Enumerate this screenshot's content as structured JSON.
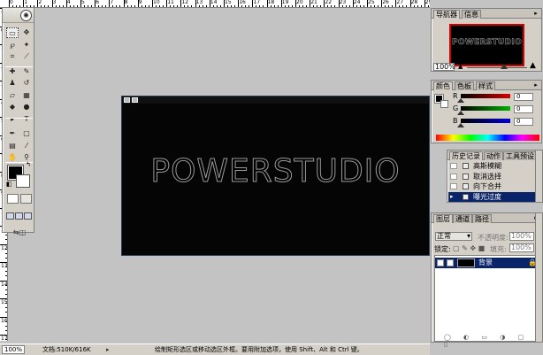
{
  "ruler": {
    "top_labels": [
      "0",
      "1",
      "2",
      "3",
      "4",
      "5",
      "6",
      "7",
      "8",
      "9",
      "10",
      "11",
      "12",
      "13",
      "14",
      "15",
      "16",
      "17",
      "18",
      "19",
      "20",
      "21",
      "22",
      "23",
      "24",
      "25",
      "26",
      "27",
      "28",
      "29"
    ],
    "left_labels": [
      "-1",
      "0",
      "1",
      "2",
      "3",
      "4",
      "5",
      "6",
      "7",
      "8",
      "9",
      "10",
      "11",
      "12",
      "13",
      "14",
      "15",
      "16",
      "17"
    ]
  },
  "toolbox": {
    "tools": [
      {
        "icon": "marquee-rect-icon",
        "glyph": "▭"
      },
      {
        "icon": "move-icon",
        "glyph": "✥"
      },
      {
        "icon": "lasso-icon",
        "glyph": "℘"
      },
      {
        "icon": "magic-wand-icon",
        "glyph": "✦"
      },
      {
        "icon": "crop-icon",
        "glyph": "⌗"
      },
      {
        "icon": "slice-icon",
        "glyph": "⟋"
      },
      {
        "icon": "healing-brush-icon",
        "glyph": "✚"
      },
      {
        "icon": "brush-icon",
        "glyph": "✎"
      },
      {
        "icon": "clone-stamp-icon",
        "glyph": "♟"
      },
      {
        "icon": "history-brush-icon",
        "glyph": "↺"
      },
      {
        "icon": "eraser-icon",
        "glyph": "▱"
      },
      {
        "icon": "gradient-icon",
        "glyph": "▦"
      },
      {
        "icon": "blur-icon",
        "glyph": "◆"
      },
      {
        "icon": "dodge-icon",
        "glyph": "●"
      },
      {
        "icon": "path-select-icon",
        "glyph": "▸"
      },
      {
        "icon": "type-icon",
        "glyph": "T"
      },
      {
        "icon": "pen-icon",
        "glyph": "✒"
      },
      {
        "icon": "shape-icon",
        "glyph": "▢"
      },
      {
        "icon": "notes-icon",
        "glyph": "▤"
      },
      {
        "icon": "eyedropper-icon",
        "glyph": "⁄"
      },
      {
        "icon": "hand-icon",
        "glyph": "✋"
      },
      {
        "icon": "zoom-icon",
        "glyph": "⚲"
      }
    ]
  },
  "document": {
    "text": "POWERSTUDIO"
  },
  "navigator": {
    "tabs": [
      "导航器",
      "信息"
    ],
    "preview_text": "POWERSTUDIO",
    "zoom": "100%"
  },
  "color": {
    "tabs": [
      "颜色",
      "色板",
      "样式"
    ],
    "channels": [
      {
        "label": "R",
        "value": "0",
        "color": "#d40000"
      },
      {
        "label": "G",
        "value": "0",
        "color": "#00b000"
      },
      {
        "label": "B",
        "value": "0",
        "color": "#0000d0"
      }
    ]
  },
  "history": {
    "tabs": [
      "历史记录",
      "动作",
      "工具预设"
    ],
    "items": [
      "高斯模糊",
      "取消选择",
      "向下合并",
      "曝光过度"
    ],
    "selected": 3
  },
  "layers": {
    "tabs": [
      "图层",
      "通道",
      "路径"
    ],
    "blend_mode": "正常",
    "opacity_label": "不透明度:",
    "opacity": "100%",
    "lock_label": "锁定:",
    "fill_label": "填充:",
    "fill": "100%",
    "layer_name": "背景"
  },
  "statusbar": {
    "zoom": "100%",
    "doc_info": "文档:510K/616K",
    "hint": "绘制矩形选区或移动选区外框。要用附加选项，使用 Shift、Alt 和 Ctrl 键。"
  }
}
